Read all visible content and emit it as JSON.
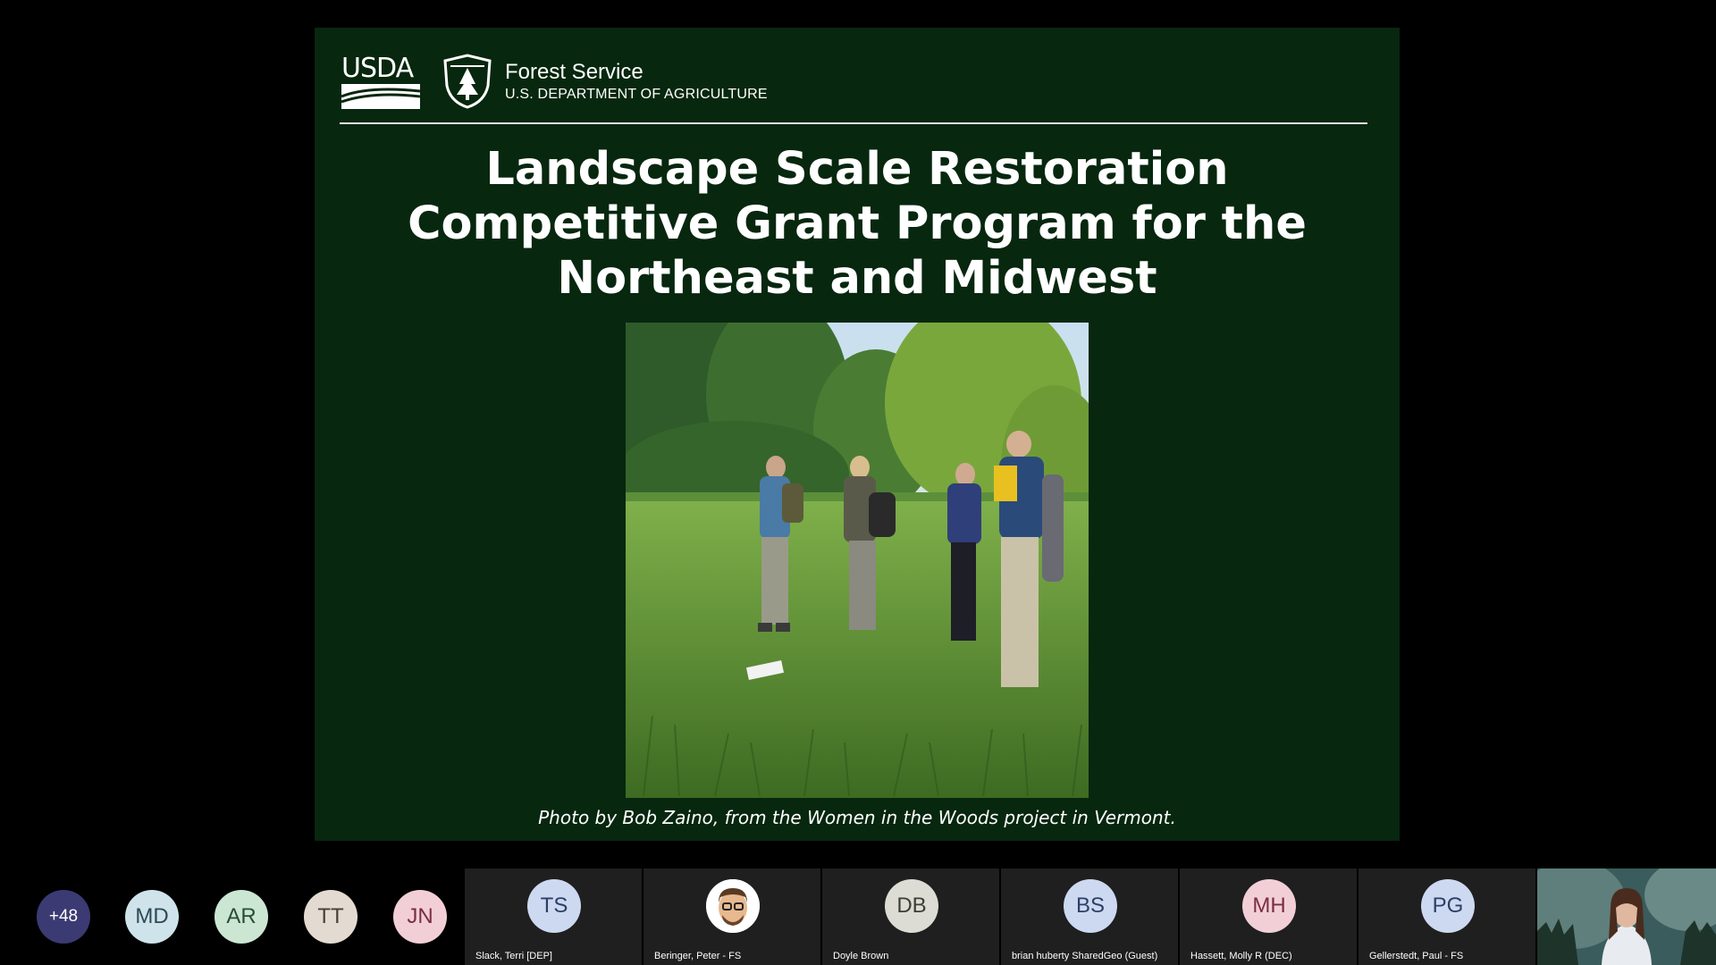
{
  "slide": {
    "usda_logo_text": "USDA",
    "agency_name": "Forest Service",
    "department": "U.S. DEPARTMENT OF AGRICULTURE",
    "title_lines": [
      "Landscape Scale Restoration",
      "Competitive Grant Program for the",
      "Northeast and Midwest"
    ],
    "caption": "Photo by Bob Zaino, from the Women in the Woods project in Vermont.",
    "colors": {
      "background": "#07270f",
      "text": "#ffffff"
    }
  },
  "participants": {
    "overflow_count": "+48",
    "avatars": [
      {
        "initials": "MD",
        "bg": "#cfe3ea",
        "fg": "#2c4a55"
      },
      {
        "initials": "AR",
        "bg": "#cbe7d4",
        "fg": "#2a4d36"
      },
      {
        "initials": "TT",
        "bg": "#e3dbd2",
        "fg": "#4a3e33"
      },
      {
        "initials": "JN",
        "bg": "#f2cfd6",
        "fg": "#7a2e42"
      }
    ],
    "tiles": [
      {
        "initials": "TS",
        "name": "Slack, Terri [DEP]",
        "bg": "#cdd9f1",
        "fg": "#2d3f66",
        "photo": false
      },
      {
        "initials": "",
        "name": "Beringer, Peter - FS",
        "bg": "#ffffff",
        "fg": "#000000",
        "photo": true
      },
      {
        "initials": "DB",
        "name": "Doyle Brown",
        "bg": "#dcdcd4",
        "fg": "#3d3d36",
        "photo": false
      },
      {
        "initials": "BS",
        "name": "brian huberty SharedGeo (Guest)",
        "bg": "#cdd9f1",
        "fg": "#2d3f66",
        "photo": false
      },
      {
        "initials": "MH",
        "name": "Hassett, Molly R (DEC)",
        "bg": "#f2cfd6",
        "fg": "#7a2e42",
        "photo": false
      },
      {
        "initials": "PG",
        "name": "Gellerstedt, Paul - FS",
        "bg": "#cdd9f1",
        "fg": "#2d3f66",
        "photo": false
      }
    ]
  }
}
